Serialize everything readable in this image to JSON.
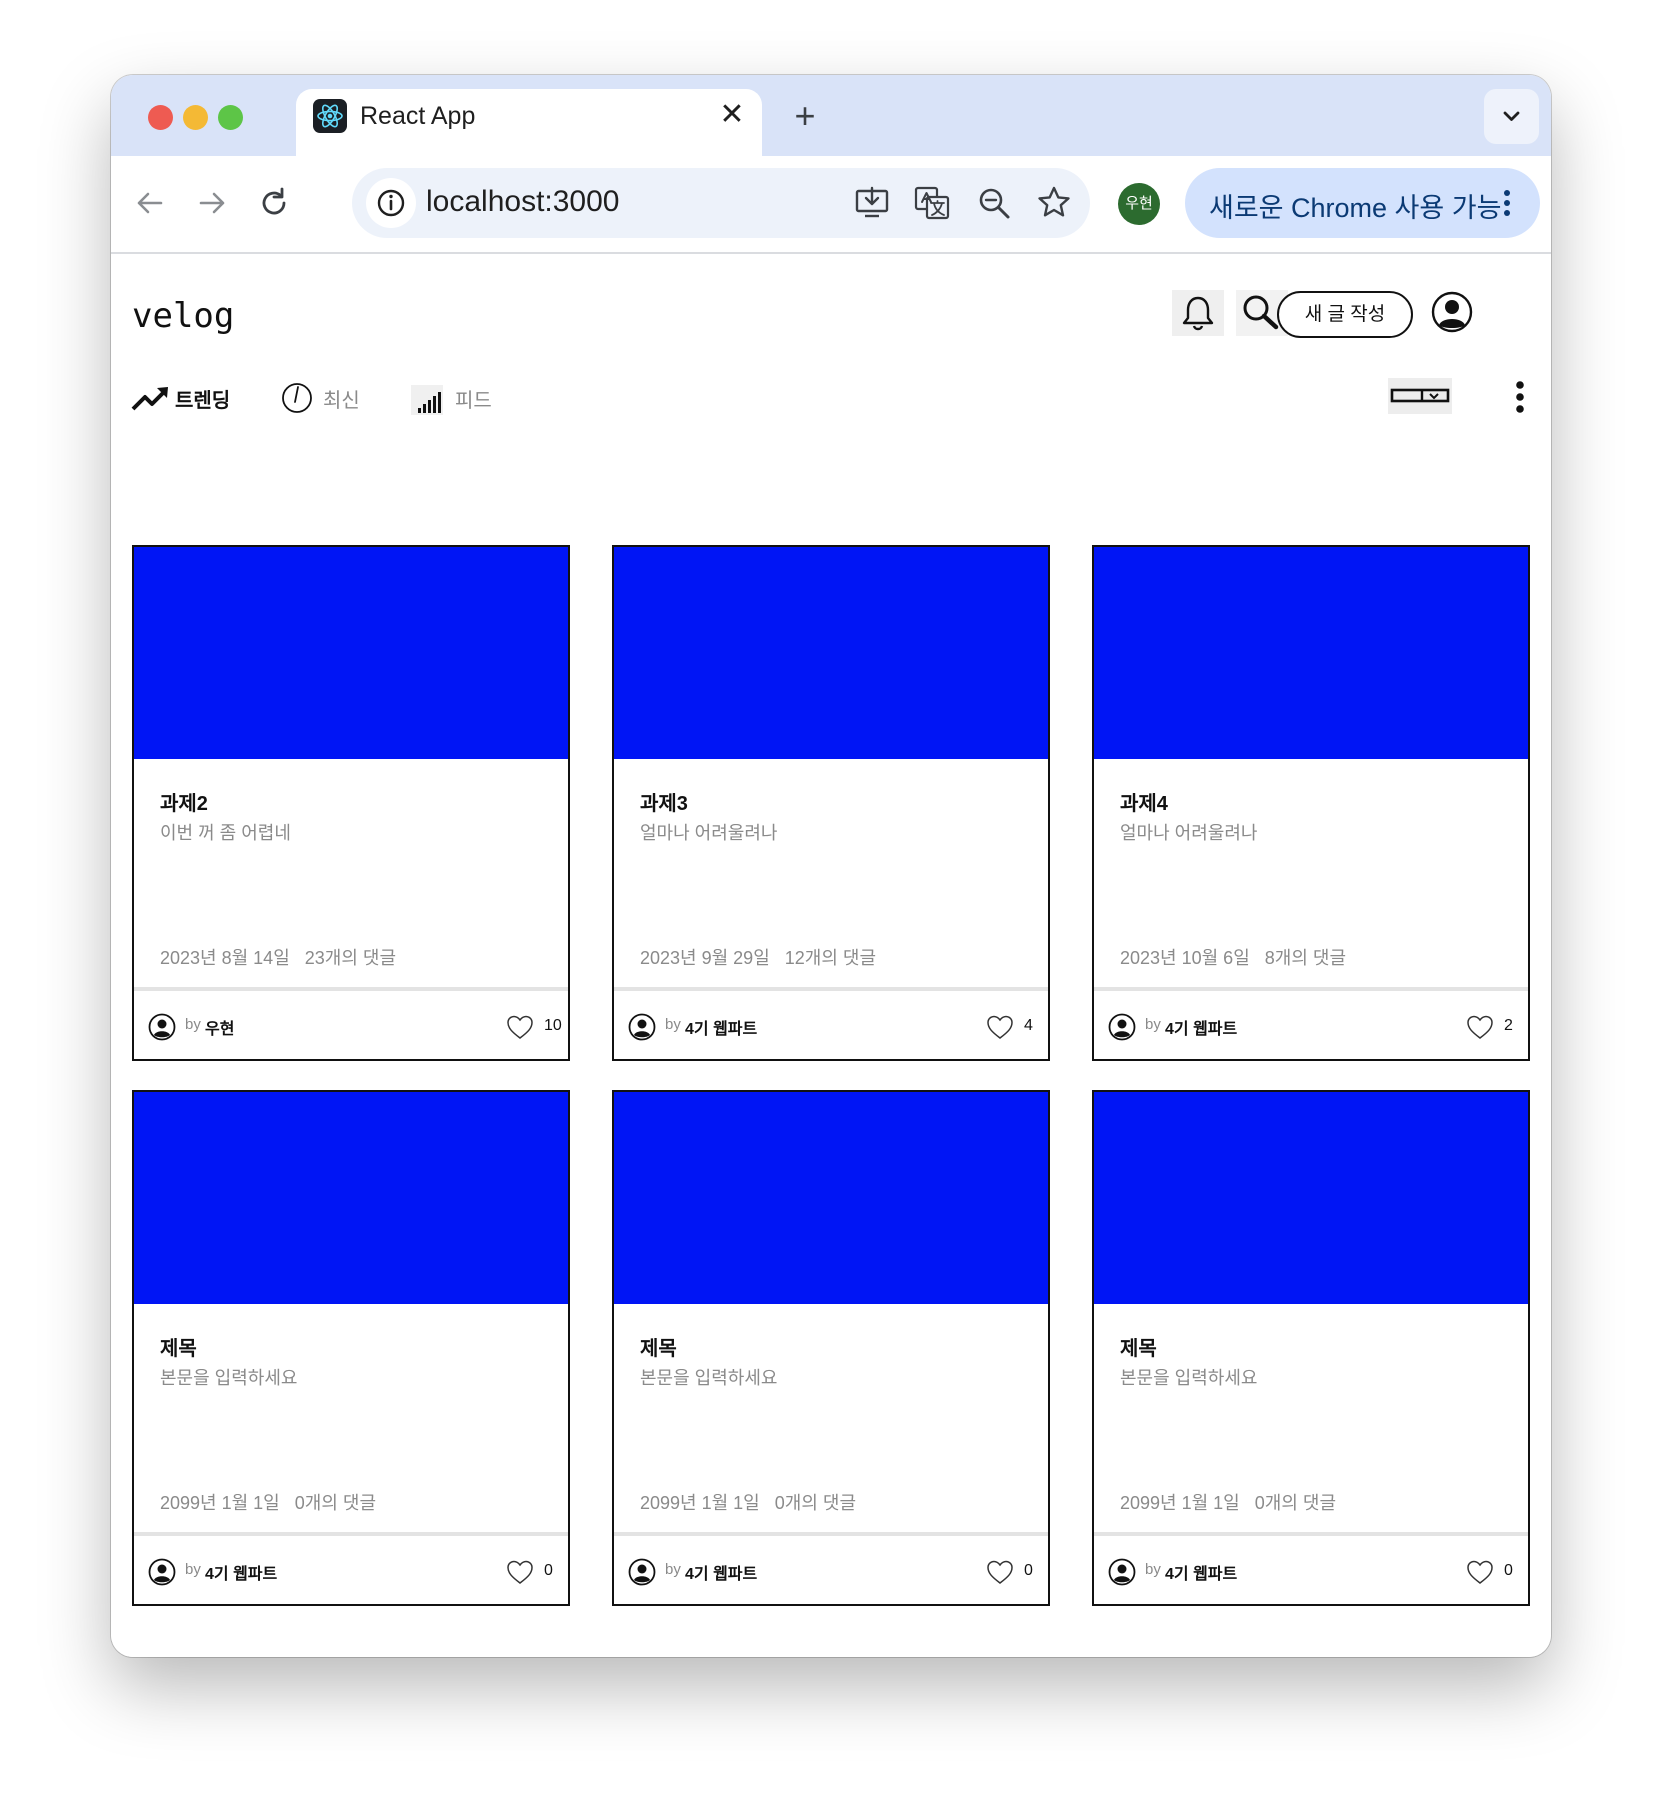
{
  "browser": {
    "tab_title": "React App",
    "close_glyph": "✕",
    "new_tab_glyph": "+",
    "url": "localhost:3000",
    "profile_initial": "우현",
    "update_label": "새로운 Chrome 사용 가능",
    "icons": [
      "back-arrow-icon",
      "forward-arrow-icon",
      "reload-icon",
      "info-icon",
      "install-app-icon",
      "translate-icon",
      "zoom-icon",
      "bookmark-star-icon",
      "kebab-menu-icon",
      "chevron-down-icon",
      "react-logo-icon"
    ]
  },
  "header": {
    "logo": "velog",
    "write_button": "새 글 작성",
    "icons": [
      "bell-icon",
      "search-icon",
      "user-avatar-icon"
    ]
  },
  "nav": {
    "tabs": [
      {
        "label": "트렌딩",
        "icon": "trending-icon",
        "active": true
      },
      {
        "label": "최신",
        "icon": "clock-icon",
        "active": false
      },
      {
        "label": "피드",
        "icon": "signal-bars-icon",
        "active": false
      }
    ]
  },
  "posts": [
    {
      "title": "과제2",
      "body": "이번 꺼 좀 어렵네",
      "date": "2023년 8월 14일",
      "comments": "23개의 댓글",
      "by": "by",
      "author": "우현",
      "likes": "10"
    },
    {
      "title": "과제3",
      "body": "얼마나 어려울려나",
      "date": "2023년 9월 29일",
      "comments": "12개의 댓글",
      "by": "by",
      "author": "4기 웹파트",
      "likes": "4"
    },
    {
      "title": "과제4",
      "body": "얼마나 어려울려나",
      "date": "2023년 10월 6일",
      "comments": "8개의 댓글",
      "by": "by",
      "author": "4기 웹파트",
      "likes": "2"
    },
    {
      "title": "제목",
      "body": "본문을 입력하세요",
      "date": "2099년 1월 1일",
      "comments": "0개의 댓글",
      "by": "by",
      "author": "4기 웹파트",
      "likes": "0"
    },
    {
      "title": "제목",
      "body": "본문을 입력하세요",
      "date": "2099년 1월 1일",
      "comments": "0개의 댓글",
      "by": "by",
      "author": "4기 웹파트",
      "likes": "0"
    },
    {
      "title": "제목",
      "body": "본문을 입력하세요",
      "date": "2099년 1월 1일",
      "comments": "0개의 댓글",
      "by": "by",
      "author": "4기 웹파트",
      "likes": "0"
    }
  ],
  "colors": {
    "thumbnail": "#0015f5",
    "tabbar": "#d9e3f8",
    "omnibox": "#edf2fa",
    "update_pill": "#d3e2fd",
    "profile": "#2c6b2f",
    "traffic_red": "#ee5b52",
    "traffic_yellow": "#f4b935",
    "traffic_green": "#5dc547"
  }
}
